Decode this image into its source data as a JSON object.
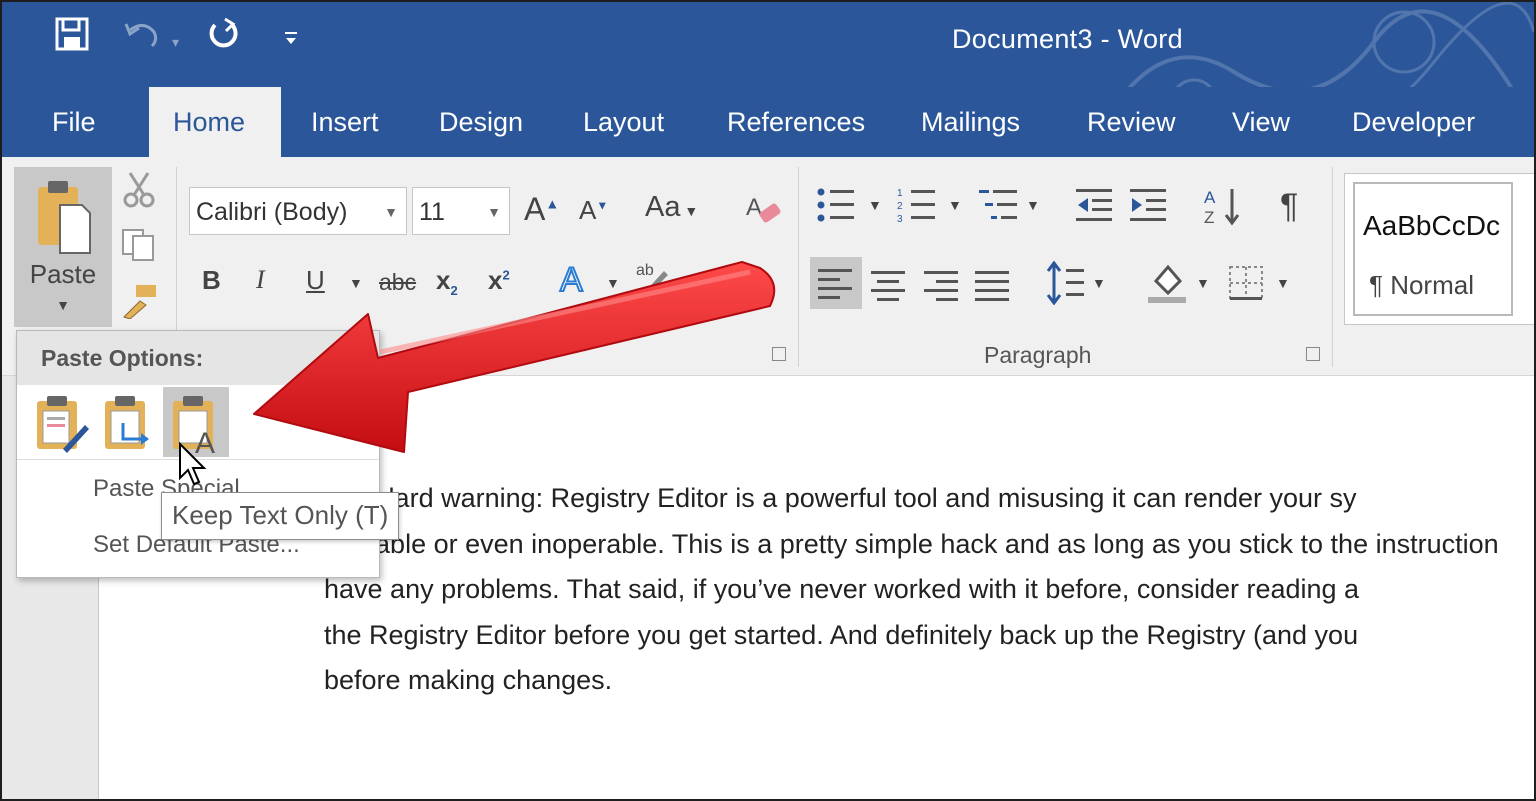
{
  "window": {
    "title": "Document3  -  Word"
  },
  "quick_access": {
    "save": "save-icon",
    "undo": "undo-icon",
    "repeat": "repeat-icon",
    "customize": "customize-qat-icon"
  },
  "tabs": [
    "File",
    "Home",
    "Insert",
    "Design",
    "Layout",
    "References",
    "Mailings",
    "Review",
    "View",
    "Developer"
  ],
  "active_tab": "Home",
  "clipboard": {
    "paste_label": "Paste"
  },
  "font": {
    "name": "Calibri (Body)",
    "size": "11",
    "change_case": "Aa",
    "bold": "B",
    "italic": "I",
    "underline": "U",
    "strike": "abc",
    "subscript": "x",
    "superscript": "x"
  },
  "paragraph": {
    "group_label": "Paragraph"
  },
  "styles": {
    "preview": "AaBbCcDc",
    "normal_label": "¶ Normal"
  },
  "paste_menu": {
    "title": "Paste Options:",
    "options": [
      "keep-source-formatting-icon",
      "merge-formatting-icon",
      "keep-text-only-icon"
    ],
    "items": [
      "Paste Special...",
      "Set Default Paste..."
    ]
  },
  "tooltip": "Keep Text Only (T)",
  "document": {
    "lines": [
      "Standard warning: Registry Editor is a powerful tool and misusing it can render your sy",
      "unstable or even inoperable. This is a pretty simple hack and as long as you stick to the instruction",
      "have any problems. That said, if you’ve never worked with it before, consider reading a",
      "the Registry Editor before you get started. And definitely back up the Registry (and you",
      "before making changes."
    ]
  },
  "colors": {
    "word_blue": "#2b579a",
    "arrow_red": "#e8141a"
  }
}
